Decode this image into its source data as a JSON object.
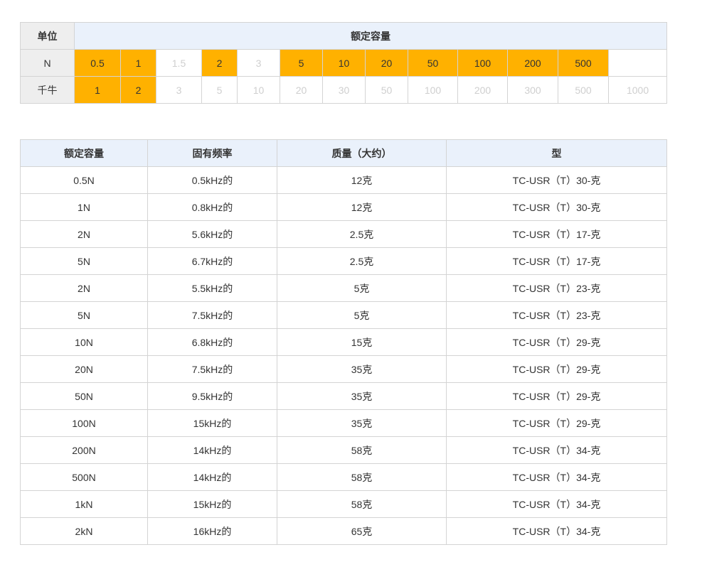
{
  "capacity_table": {
    "unit_header": "单位",
    "capacity_header": "额定容量",
    "rows": [
      {
        "unit": "N",
        "cells": [
          {
            "v": "0.5",
            "on": true
          },
          {
            "v": "1",
            "on": true
          },
          {
            "v": "1.5",
            "on": false
          },
          {
            "v": "2",
            "on": true
          },
          {
            "v": "3",
            "on": false
          },
          {
            "v": "5",
            "on": true
          },
          {
            "v": "10",
            "on": true
          },
          {
            "v": "20",
            "on": true
          },
          {
            "v": "50",
            "on": true
          },
          {
            "v": "100",
            "on": true
          },
          {
            "v": "200",
            "on": true
          },
          {
            "v": "500",
            "on": true
          },
          {
            "v": "",
            "on": false
          }
        ]
      },
      {
        "unit": "千牛",
        "cells": [
          {
            "v": "1",
            "on": true
          },
          {
            "v": "2",
            "on": true
          },
          {
            "v": "3",
            "on": false
          },
          {
            "v": "5",
            "on": false
          },
          {
            "v": "10",
            "on": false
          },
          {
            "v": "20",
            "on": false
          },
          {
            "v": "30",
            "on": false
          },
          {
            "v": "50",
            "on": false
          },
          {
            "v": "100",
            "on": false
          },
          {
            "v": "200",
            "on": false
          },
          {
            "v": "300",
            "on": false
          },
          {
            "v": "500",
            "on": false
          },
          {
            "v": "1000",
            "on": false
          }
        ]
      }
    ],
    "colors": {
      "highlight": "#ffb100",
      "header_bg": "#eaf1fb",
      "unit_bg": "#eeeeee",
      "disabled_text": "#cfcfcf"
    }
  },
  "spec_table": {
    "headers": [
      "额定容量",
      "固有频率",
      "质量（大约）",
      "型"
    ],
    "rows": [
      [
        "0.5N",
        "0.5kHz的",
        "12克",
        "TC-USR（T）30-克"
      ],
      [
        "1N",
        "0.8kHz的",
        "12克",
        "TC-USR（T）30-克"
      ],
      [
        "2N",
        "5.6kHz的",
        "2.5克",
        "TC-USR（T）17-克"
      ],
      [
        "5N",
        "6.7kHz的",
        "2.5克",
        "TC-USR（T）17-克"
      ],
      [
        "2N",
        "5.5kHz的",
        "5克",
        "TC-USR（T）23-克"
      ],
      [
        "5N",
        "7.5kHz的",
        "5克",
        "TC-USR（T）23-克"
      ],
      [
        "10N",
        "6.8kHz的",
        "15克",
        "TC-USR（T）29-克"
      ],
      [
        "20N",
        "7.5kHz的",
        "35克",
        "TC-USR（T）29-克"
      ],
      [
        "50N",
        "9.5kHz的",
        "35克",
        "TC-USR（T）29-克"
      ],
      [
        "100N",
        "15kHz的",
        "35克",
        "TC-USR（T）29-克"
      ],
      [
        "200N",
        "14kHz的",
        "58克",
        "TC-USR（T）34-克"
      ],
      [
        "500N",
        "14kHz的",
        "58克",
        "TC-USR（T）34-克"
      ],
      [
        "1kN",
        "15kHz的",
        "58克",
        "TC-USR（T）34-克"
      ],
      [
        "2kN",
        "16kHz的",
        "65克",
        "TC-USR（T）34-克"
      ]
    ]
  }
}
